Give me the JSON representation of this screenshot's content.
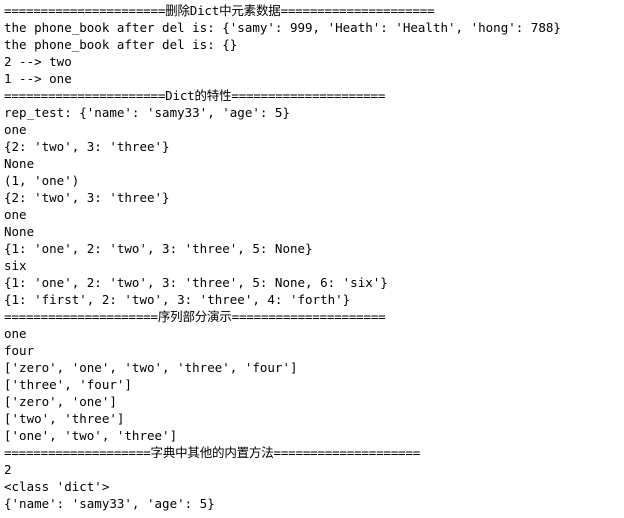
{
  "terminal": {
    "type": "python-console-output",
    "foreground_color": "#000000",
    "background_color": "#ffffff",
    "lines": [
      {
        "id": "sep-del-dict",
        "kind": "separator",
        "text": "======================删除Dict中元素数据====================="
      },
      {
        "id": "phone-book-del-1",
        "kind": "output",
        "text": "the phone_book after del is: {'samy': 999, 'Heath': 'Health', 'hong': 788}"
      },
      {
        "id": "phone-book-del-2",
        "kind": "output",
        "text": "the phone_book after del is: {}"
      },
      {
        "id": "popitem-2-two",
        "kind": "output",
        "text": "2 --> two"
      },
      {
        "id": "popitem-1-one",
        "kind": "output",
        "text": "1 --> one"
      },
      {
        "id": "sep-dict-features",
        "kind": "separator",
        "text": "======================Dict的特性====================="
      },
      {
        "id": "rep-test",
        "kind": "output",
        "text": "rep_test: {'name': 'samy33', 'age': 5}"
      },
      {
        "id": "pop-one",
        "kind": "output",
        "text": "one"
      },
      {
        "id": "dict-after-pop",
        "kind": "output",
        "text": "{2: 'two', 3: 'three'}"
      },
      {
        "id": "get-none-1",
        "kind": "output",
        "text": "None"
      },
      {
        "id": "popitem-tuple",
        "kind": "output",
        "text": "(1, 'one')"
      },
      {
        "id": "dict-after-popitem",
        "kind": "output",
        "text": "{2: 'two', 3: 'three'}"
      },
      {
        "id": "get-one",
        "kind": "output",
        "text": "one"
      },
      {
        "id": "get-none-2",
        "kind": "output",
        "text": "None"
      },
      {
        "id": "setdefault-none",
        "kind": "output",
        "text": "{1: 'one', 2: 'two', 3: 'three', 5: None}"
      },
      {
        "id": "setdefault-six",
        "kind": "output",
        "text": "six"
      },
      {
        "id": "dict-with-six",
        "kind": "output",
        "text": "{1: 'one', 2: 'two', 3: 'three', 5: None, 6: 'six'}"
      },
      {
        "id": "dict-updated",
        "kind": "output",
        "text": "{1: 'first', 2: 'two', 3: 'three', 4: 'forth'}"
      },
      {
        "id": "sep-sequence-demo",
        "kind": "separator",
        "text": "=====================序列部分演示====================="
      },
      {
        "id": "seq-index-one",
        "kind": "output",
        "text": "one"
      },
      {
        "id": "seq-index-four",
        "kind": "output",
        "text": "four"
      },
      {
        "id": "list-full",
        "kind": "output",
        "text": "['zero', 'one', 'two', 'three', 'four']"
      },
      {
        "id": "list-slice-3-4",
        "kind": "output",
        "text": "['three', 'four']"
      },
      {
        "id": "list-slice-0-1",
        "kind": "output",
        "text": "['zero', 'one']"
      },
      {
        "id": "list-slice-two-three",
        "kind": "output",
        "text": "['two', 'three']"
      },
      {
        "id": "list-slice-one-three",
        "kind": "output",
        "text": "['one', 'two', 'three']"
      },
      {
        "id": "sep-other-methods",
        "kind": "separator",
        "text": "====================字典中其他的内置方法===================="
      },
      {
        "id": "len-result",
        "kind": "output",
        "text": "2"
      },
      {
        "id": "type-result",
        "kind": "output",
        "text": "<class 'dict'>"
      },
      {
        "id": "final-dict",
        "kind": "output",
        "text": "{'name': 'samy33', 'age': 5}"
      }
    ]
  }
}
